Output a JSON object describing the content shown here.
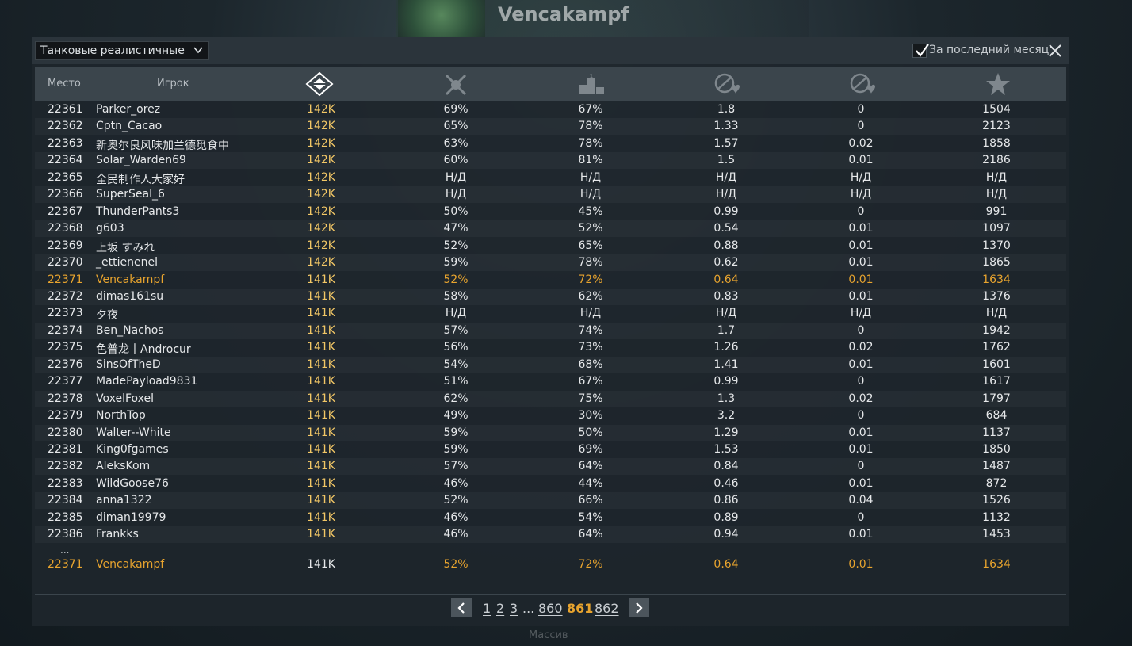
{
  "background": {
    "player_name": "Vencakampf",
    "bottom_text": "Массив"
  },
  "topbar": {
    "mode_select": "Танковые реалистичные бои",
    "last_month_label": "За последний месяц",
    "last_month_checked": true
  },
  "header": {
    "place": "Место",
    "player": "Игрок",
    "icons": [
      "rank-score-icon",
      "battles-won-icon",
      "podium-icon",
      "kills-per-death-icon",
      "kills-per-spawn-icon",
      "star-icon"
    ]
  },
  "rows": [
    {
      "place": "22361",
      "name": "Parker_orez",
      "score": "142K",
      "a": "69%",
      "b": "67%",
      "c": "1.8",
      "d": "0",
      "e": "1504"
    },
    {
      "place": "22362",
      "name": "Cptn_Cacao",
      "score": "142K",
      "a": "65%",
      "b": "78%",
      "c": "1.33",
      "d": "0",
      "e": "2123"
    },
    {
      "place": "22363",
      "name": "新奥尔良风味加兰德觅食中",
      "score": "142K",
      "a": "63%",
      "b": "78%",
      "c": "1.57",
      "d": "0.02",
      "e": "1858"
    },
    {
      "place": "22364",
      "name": "Solar_Warden69",
      "score": "142K",
      "a": "60%",
      "b": "81%",
      "c": "1.5",
      "d": "0.01",
      "e": "2186"
    },
    {
      "place": "22365",
      "name": "全民制作人大家好",
      "score": "142K",
      "a": "Н/Д",
      "b": "Н/Д",
      "c": "Н/Д",
      "d": "Н/Д",
      "e": "Н/Д"
    },
    {
      "place": "22366",
      "name": "SuperSeal_6",
      "score": "142K",
      "a": "Н/Д",
      "b": "Н/Д",
      "c": "Н/Д",
      "d": "Н/Д",
      "e": "Н/Д"
    },
    {
      "place": "22367",
      "name": "ThunderPants3",
      "score": "142K",
      "a": "50%",
      "b": "45%",
      "c": "0.99",
      "d": "0",
      "e": "991"
    },
    {
      "place": "22368",
      "name": "g603",
      "score": "142K",
      "a": "47%",
      "b": "52%",
      "c": "0.54",
      "d": "0.01",
      "e": "1097"
    },
    {
      "place": "22369",
      "name": "上坂 すみれ",
      "score": "142K",
      "a": "52%",
      "b": "65%",
      "c": "0.88",
      "d": "0.01",
      "e": "1370"
    },
    {
      "place": "22370",
      "name": "_ettienenel",
      "score": "142K",
      "a": "59%",
      "b": "78%",
      "c": "0.62",
      "d": "0.01",
      "e": "1865"
    },
    {
      "place": "22371",
      "name": "Vencakampf",
      "score": "141K",
      "a": "52%",
      "b": "72%",
      "c": "0.64",
      "d": "0.01",
      "e": "1634",
      "highlight": true
    },
    {
      "place": "22372",
      "name": "dimas161su",
      "score": "141K",
      "a": "58%",
      "b": "62%",
      "c": "0.83",
      "d": "0.01",
      "e": "1376"
    },
    {
      "place": "22373",
      "name": "夕夜",
      "score": "141K",
      "a": "Н/Д",
      "b": "Н/Д",
      "c": "Н/Д",
      "d": "Н/Д",
      "e": "Н/Д"
    },
    {
      "place": "22374",
      "name": "Ben_Nachos",
      "score": "141K",
      "a": "57%",
      "b": "74%",
      "c": "1.7",
      "d": "0",
      "e": "1942"
    },
    {
      "place": "22375",
      "name": "色普龙丨Androcur",
      "score": "141K",
      "a": "56%",
      "b": "73%",
      "c": "1.26",
      "d": "0.02",
      "e": "1762"
    },
    {
      "place": "22376",
      "name": "SinsOfTheD",
      "score": "141K",
      "a": "54%",
      "b": "68%",
      "c": "1.41",
      "d": "0.01",
      "e": "1601"
    },
    {
      "place": "22377",
      "name": "MadePayload9831",
      "score": "141K",
      "a": "51%",
      "b": "67%",
      "c": "0.99",
      "d": "0",
      "e": "1617"
    },
    {
      "place": "22378",
      "name": "VoxelFoxel",
      "score": "141K",
      "a": "62%",
      "b": "75%",
      "c": "1.3",
      "d": "0.02",
      "e": "1797"
    },
    {
      "place": "22379",
      "name": "NorthTop",
      "score": "141K",
      "a": "49%",
      "b": "30%",
      "c": "3.2",
      "d": "0",
      "e": "684"
    },
    {
      "place": "22380",
      "name": "Walter--White",
      "score": "141K",
      "a": "59%",
      "b": "50%",
      "c": "1.29",
      "d": "0.01",
      "e": "1137"
    },
    {
      "place": "22381",
      "name": "King0fgames",
      "score": "141K",
      "a": "59%",
      "b": "69%",
      "c": "1.53",
      "d": "0.01",
      "e": "1850"
    },
    {
      "place": "22382",
      "name": "AleksKom",
      "score": "141K",
      "a": "57%",
      "b": "64%",
      "c": "0.84",
      "d": "0",
      "e": "1487"
    },
    {
      "place": "22383",
      "name": "WildGoose76",
      "score": "141K",
      "a": "46%",
      "b": "44%",
      "c": "0.46",
      "d": "0.01",
      "e": "872"
    },
    {
      "place": "22384",
      "name": "anna1322",
      "score": "141K",
      "a": "52%",
      "b": "66%",
      "c": "0.86",
      "d": "0.04",
      "e": "1526"
    },
    {
      "place": "22385",
      "name": "diman19979",
      "score": "141K",
      "a": "46%",
      "b": "54%",
      "c": "0.89",
      "d": "0",
      "e": "1132"
    },
    {
      "place": "22386",
      "name": "Frankks",
      "score": "141K",
      "a": "46%",
      "b": "64%",
      "c": "0.94",
      "d": "0.01",
      "e": "1453"
    }
  ],
  "ellipsis": "...",
  "own_row": {
    "place": "22371",
    "name": "Vencakampf",
    "score": "141K",
    "a": "52%",
    "b": "72%",
    "c": "0.64",
    "d": "0.01",
    "e": "1634"
  },
  "pagination": {
    "pages": [
      "1",
      "2",
      "3",
      "860",
      "861",
      "862"
    ],
    "ellipsis": "...",
    "current": "861"
  },
  "colors": {
    "highlight": "#e8a42e",
    "score": "#f2c766"
  }
}
